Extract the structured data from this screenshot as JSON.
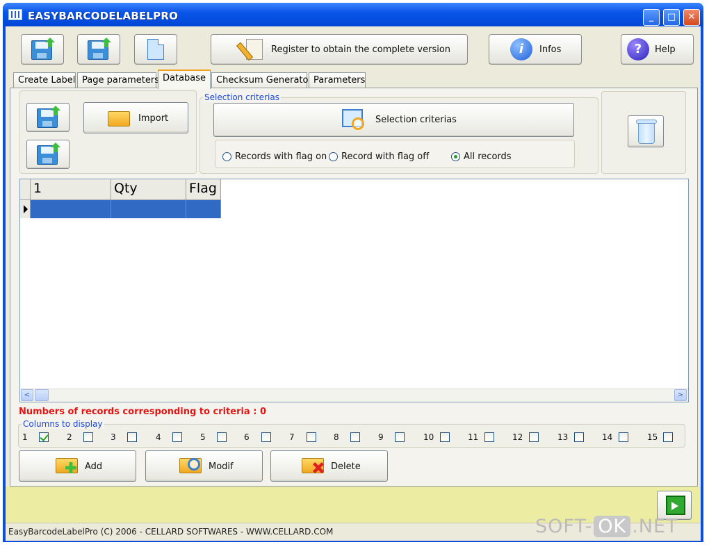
{
  "window": {
    "title": "EASYBARCODELABELPRO",
    "min_label": "_",
    "max_label": "□",
    "close_label": "✕"
  },
  "toolbar": {
    "register_label": "Register to obtain the complete version",
    "infos_label": "Infos",
    "help_label": "Help",
    "infos_glyph": "i",
    "help_glyph": "?"
  },
  "tabs": [
    {
      "label": "Create Label"
    },
    {
      "label": "Page parameters"
    },
    {
      "label": "Database",
      "active": true
    },
    {
      "label": "Checksum Generator"
    },
    {
      "label": "Parameters"
    }
  ],
  "database": {
    "import_label": "Import",
    "selection_group_title": "Selection criterias",
    "selection_button_label": "Selection criterias",
    "radio_flag_on": "Records with flag on",
    "radio_flag_off": "Record with flag off",
    "radio_all": "All records",
    "selected_radio": "All records",
    "grid_columns": [
      "1",
      "Qty",
      "Flag"
    ],
    "records_text": "Numbers of records corresponding to criteria : 0",
    "columns_group_title": "Columns to display",
    "columns": [
      {
        "label": "1",
        "checked": true
      },
      {
        "label": "2",
        "checked": false
      },
      {
        "label": "3",
        "checked": false
      },
      {
        "label": "4",
        "checked": false
      },
      {
        "label": "5",
        "checked": false
      },
      {
        "label": "6",
        "checked": false
      },
      {
        "label": "7",
        "checked": false
      },
      {
        "label": "8",
        "checked": false
      },
      {
        "label": "9",
        "checked": false
      },
      {
        "label": "10",
        "checked": false
      },
      {
        "label": "11",
        "checked": false
      },
      {
        "label": "12",
        "checked": false
      },
      {
        "label": "13",
        "checked": false
      },
      {
        "label": "14",
        "checked": false
      },
      {
        "label": "15",
        "checked": false
      }
    ],
    "add_label": "Add",
    "modif_label": "Modif",
    "delete_label": "Delete",
    "scroll_left": "<",
    "scroll_right": ">"
  },
  "status": {
    "text": "EasyBarcodeLabelPro (C) 2006 - CELLARD SOFTWARES - WWW.CELLARD.COM"
  },
  "watermark": {
    "prefix": "SOFT-",
    "ok": "OK",
    "suffix": ".NET"
  },
  "colors": {
    "titlebar": "#0a55e8",
    "records_text": "#e41515",
    "group_title": "#1c48d8",
    "grid_selection": "#316ac5"
  }
}
